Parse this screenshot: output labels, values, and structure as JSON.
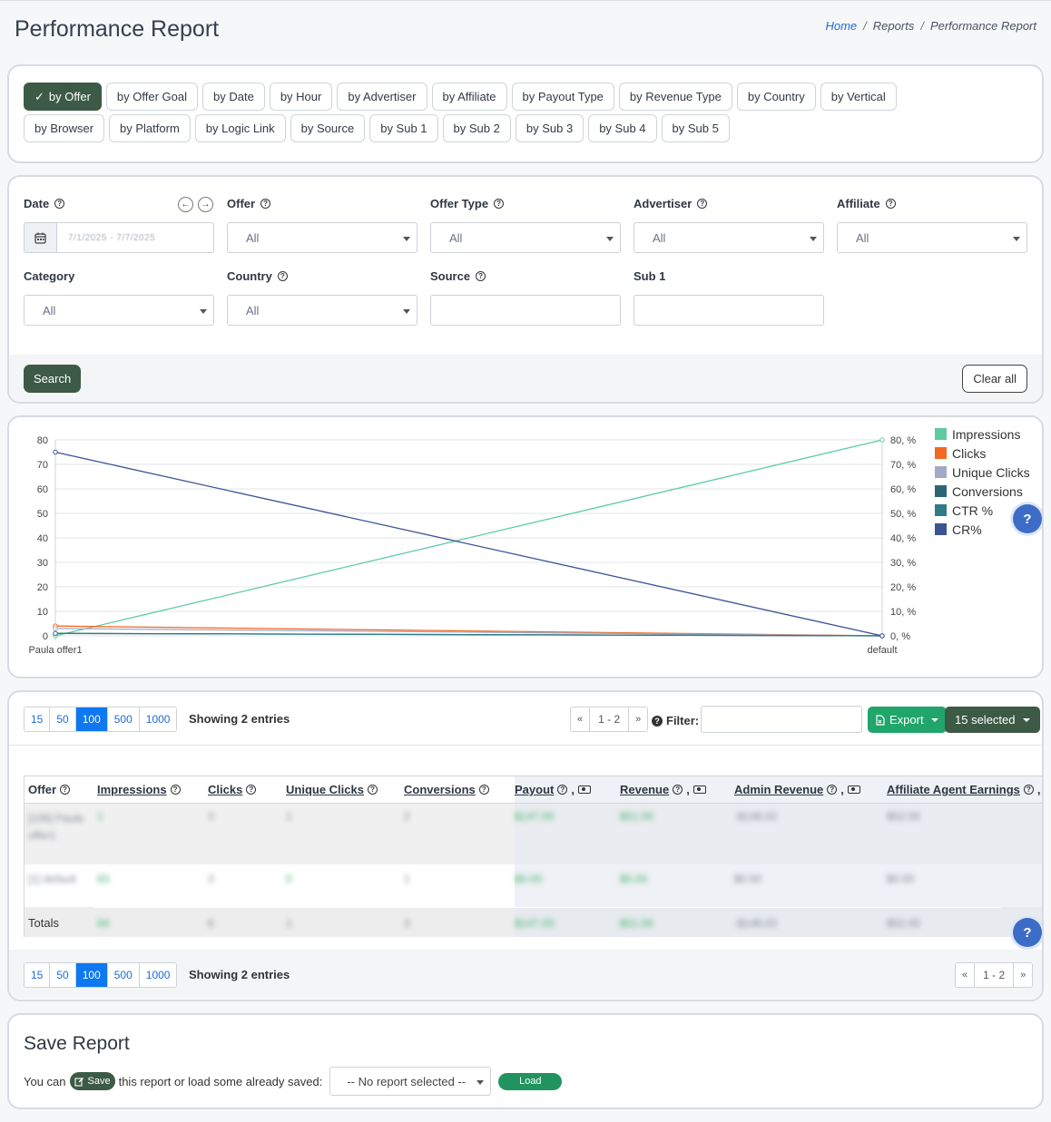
{
  "page": {
    "title": "Performance Report",
    "breadcrumb": {
      "home": "Home",
      "reports": "Reports",
      "current": "Performance Report",
      "separator": "/"
    }
  },
  "groups": [
    {
      "label": "by Offer",
      "active": true
    },
    {
      "label": "by Offer Goal"
    },
    {
      "label": "by Date"
    },
    {
      "label": "by Hour"
    },
    {
      "label": "by Advertiser"
    },
    {
      "label": "by Affiliate"
    },
    {
      "label": "by Payout Type"
    },
    {
      "label": "by Revenue Type"
    },
    {
      "label": "by Country"
    },
    {
      "label": "by Vertical"
    },
    {
      "label": "by Browser"
    },
    {
      "label": "by Platform"
    },
    {
      "label": "by Logic Link"
    },
    {
      "label": "by Source"
    },
    {
      "label": "by Sub 1"
    },
    {
      "label": "by Sub 2"
    },
    {
      "label": "by Sub 3"
    },
    {
      "label": "by Sub 4"
    },
    {
      "label": "by Sub 5"
    }
  ],
  "filters": {
    "date_label": "Date",
    "date_value": "7/1/2025 - 7/7/2025",
    "offer_label": "Offer",
    "offer_value": "All",
    "offer_type_label": "Offer Type",
    "offer_type_value": "All",
    "advertiser_label": "Advertiser",
    "advertiser_value": "All",
    "affiliate_label": "Affiliate",
    "affiliate_value": "All",
    "category_label": "Category",
    "category_value": "All",
    "country_label": "Country",
    "country_value": "All",
    "source_label": "Source",
    "sub1_label": "Sub 1",
    "search_label": "Search",
    "clear_label": "Clear all"
  },
  "chart_data": {
    "type": "line",
    "categories": [
      "Paula offer1",
      "default"
    ],
    "y_left": {
      "ylim": [
        0,
        80
      ],
      "ticks": [
        "0",
        "10",
        "20",
        "30",
        "40",
        "50",
        "60",
        "70",
        "80"
      ]
    },
    "y_right": {
      "ylim": [
        0,
        80
      ],
      "ticks": [
        "0, %",
        "10, %",
        "20, %",
        "30, %",
        "40, %",
        "50, %",
        "60, %",
        "70, %",
        "80, %"
      ]
    },
    "grid": true,
    "legend_position": "right",
    "series": [
      {
        "name": "Impressions",
        "color": "#5ecba1",
        "values": [
          0,
          80
        ],
        "axis": "right"
      },
      {
        "name": "Clicks",
        "color": "#f26722",
        "values": [
          4,
          0
        ]
      },
      {
        "name": "Unique Clicks",
        "color": "#a3a8c6",
        "values": [
          3,
          0
        ]
      },
      {
        "name": "Conversions",
        "color": "#2c6671",
        "values": [
          1,
          0
        ]
      },
      {
        "name": "CTR %",
        "color": "#2f7b86",
        "values": [
          1,
          0
        ],
        "axis": "right"
      },
      {
        "name": "CR%",
        "color": "#3d5493",
        "values": [
          75,
          0
        ],
        "axis": "right"
      }
    ]
  },
  "table": {
    "page_sizes": [
      "15",
      "50",
      "100",
      "500",
      "1000"
    ],
    "active_page_size": "100",
    "showing": "Showing 2 entries",
    "pager": {
      "prev": "«",
      "range": "1 - 2",
      "next": "»"
    },
    "filter_label": "Filter:",
    "export_label": "Export",
    "selected_label": "15 selected",
    "columns": [
      {
        "label": "Offer"
      },
      {
        "label": "Impressions"
      },
      {
        "label": "Clicks"
      },
      {
        "label": "Unique Clicks"
      },
      {
        "label": "Conversions"
      },
      {
        "label": "Payout",
        "money": true
      },
      {
        "label": "Revenue",
        "money": true
      },
      {
        "label": "Admin Revenue",
        "money": true
      },
      {
        "label": "Affiliate Agent Earnings",
        "money": true
      }
    ],
    "rows": [
      {
        "offer": "[106] Paula offer1",
        "impressions": "1",
        "clicks": "3",
        "unique_clicks": "1",
        "conversions": "2",
        "payout": "$147.00",
        "revenue": "$51.00",
        "admin_revenue": "-$146.02",
        "agent_earnings": "$52.00"
      },
      {
        "offer": "[1] default",
        "impressions": "83",
        "clicks": "3",
        "unique_clicks": "0",
        "conversions": "1",
        "payout": "$0.00",
        "revenue": "$0.00",
        "admin_revenue": "$0.00",
        "agent_earnings": "$0.00"
      }
    ],
    "totals": {
      "label": "Totals",
      "impressions": "84",
      "clicks": "6",
      "unique_clicks": "1",
      "conversions": "3",
      "payout": "$147.00",
      "revenue": "$51.00",
      "admin_revenue": "-$146.02",
      "agent_earnings": "$52.00"
    }
  },
  "save_report": {
    "title": "Save Report",
    "text_before": "You can",
    "save_label": "Save",
    "text_after": "this report or load some already saved:",
    "select_value": "-- No report selected --",
    "load_label": "Load"
  }
}
